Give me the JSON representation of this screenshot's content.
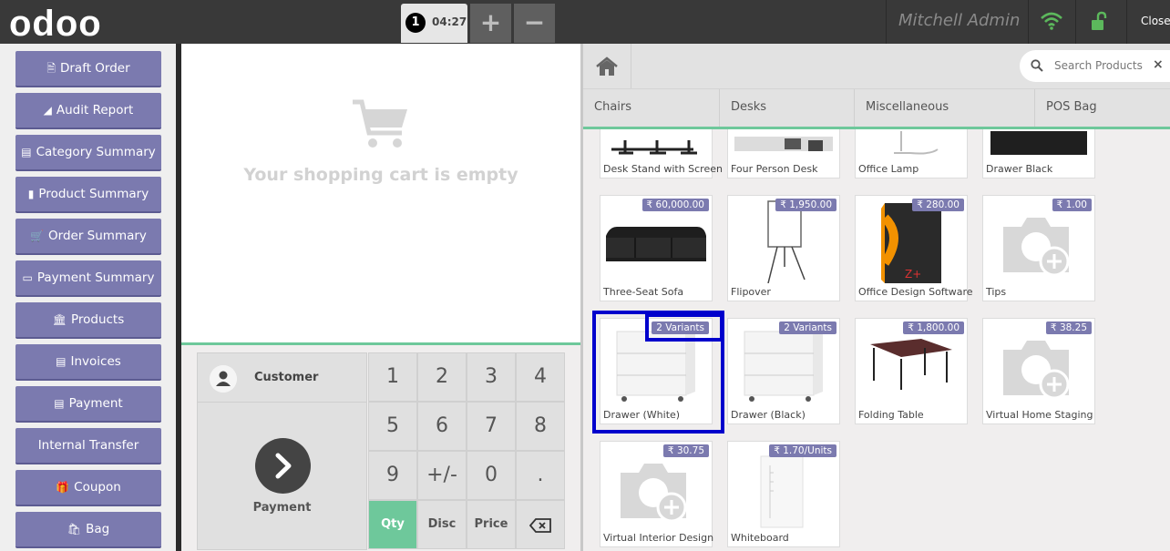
{
  "topbar": {
    "logo": "odoo",
    "order_number": "1",
    "order_time": "04:27",
    "add_order_label": "+",
    "remove_order_label": "−",
    "user_name": "Mitchell Admin",
    "close_label": "Close"
  },
  "sidebar": {
    "items": [
      {
        "label": "Draft Order",
        "icon": "file-icon"
      },
      {
        "label": "Audit Report",
        "icon": "area-chart-icon"
      },
      {
        "label": "Category Summary",
        "icon": "bar-chart-icon"
      },
      {
        "label": "Product Summary",
        "icon": "document-icon"
      },
      {
        "label": "Order Summary",
        "icon": "cart-icon"
      },
      {
        "label": "Payment Summary",
        "icon": "credit-card-icon"
      },
      {
        "label": "Products",
        "icon": "bank-icon"
      },
      {
        "label": "Invoices",
        "icon": "money-icon"
      },
      {
        "label": "Payment",
        "icon": "money-icon"
      },
      {
        "label": "Internal Transfer",
        "icon": ""
      },
      {
        "label": "Coupon",
        "icon": "gift-icon"
      },
      {
        "label": "Bag",
        "icon": "shopping-bag-icon"
      }
    ]
  },
  "order": {
    "empty_text": "Your shopping cart is empty"
  },
  "pad": {
    "customer_label": "Customer",
    "payment_label": "Payment",
    "keys": [
      "1",
      "2",
      "3",
      "4",
      "5",
      "6",
      "7",
      "8",
      "9",
      "+/-",
      "0",
      "."
    ],
    "qty_label": "Qty",
    "disc_label": "Disc",
    "price_label": "Price"
  },
  "search": {
    "placeholder": "Search Products",
    "clear": "×"
  },
  "categories": [
    "Chairs",
    "Desks",
    "Miscellaneous",
    "POS Bag"
  ],
  "products": [
    {
      "name": "Desk Stand with Screen",
      "price": ""
    },
    {
      "name": "Four Person Desk",
      "price": ""
    },
    {
      "name": "Office Lamp",
      "price": ""
    },
    {
      "name": "Drawer Black",
      "price": ""
    },
    {
      "name": "Three-Seat Sofa",
      "price": "₹ 60,000.00"
    },
    {
      "name": "Flipover",
      "price": "₹ 1,950.00"
    },
    {
      "name": "Office Design Software",
      "price": "₹ 280.00"
    },
    {
      "name": "Tips",
      "price": "₹ 1.00"
    },
    {
      "name": "Drawer (White)",
      "price": "2 Variants"
    },
    {
      "name": "Drawer (Black)",
      "price": "2 Variants"
    },
    {
      "name": "Folding Table",
      "price": "₹ 1,800.00"
    },
    {
      "name": "Virtual Home Staging",
      "price": "₹ 38.25"
    },
    {
      "name": "Virtual Interior Design",
      "price": "₹ 30.75"
    },
    {
      "name": "Whiteboard",
      "price": "₹ 1.70/Units"
    }
  ],
  "colors": {
    "accent": "#7b7aaf",
    "active_key": "#6ec89b",
    "topbar": "#393939",
    "highlight": "#0000cc"
  }
}
